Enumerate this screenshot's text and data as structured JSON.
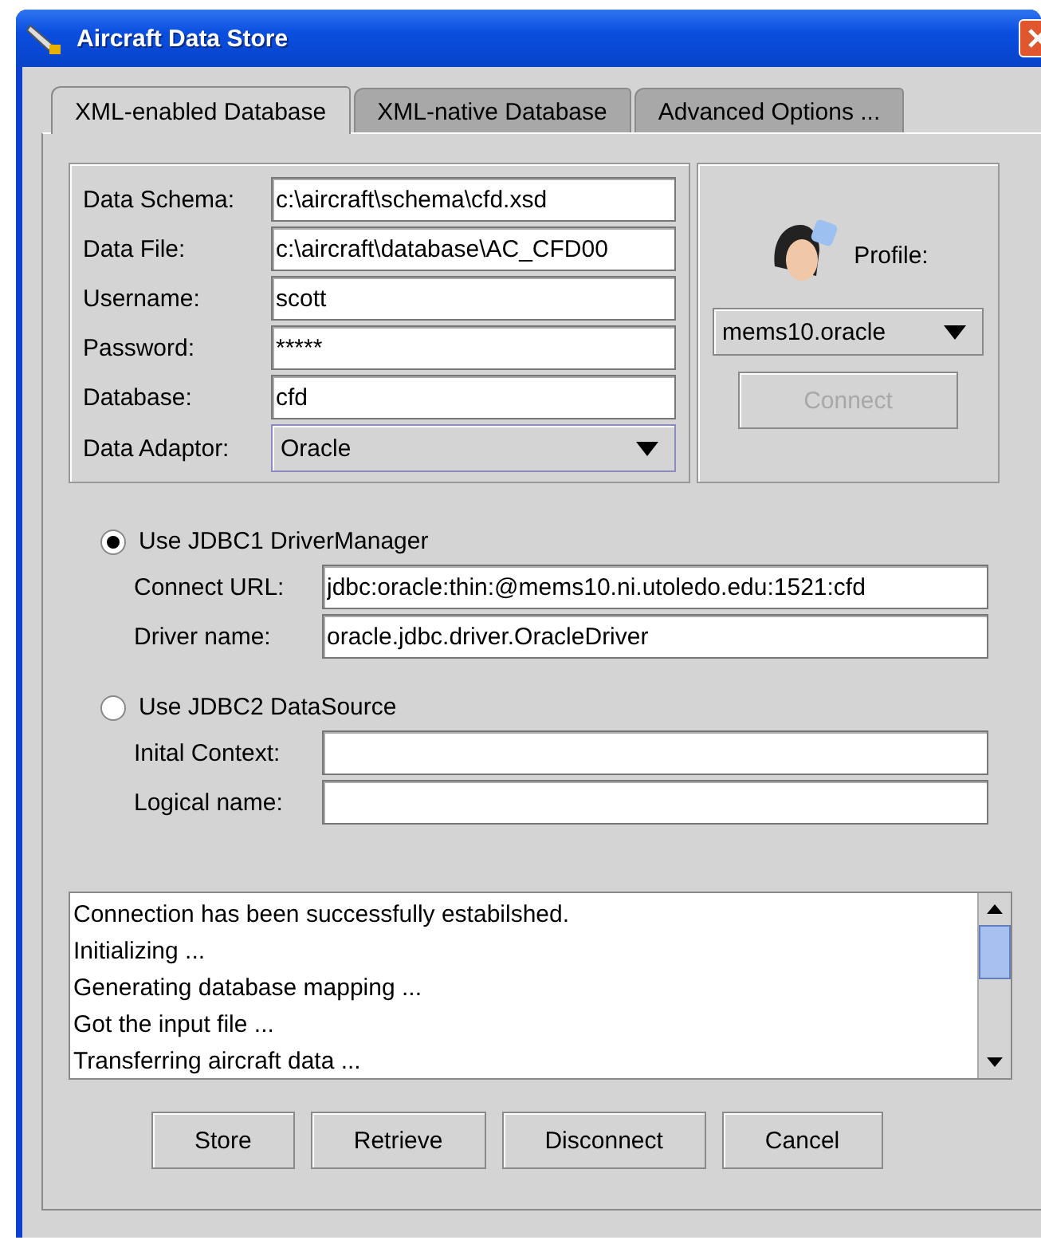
{
  "window": {
    "title": "Aircraft Data Store"
  },
  "tabs": [
    {
      "label": "XML-enabled Database",
      "selected": true
    },
    {
      "label": "XML-native Database",
      "selected": false
    },
    {
      "label": "Advanced Options ...",
      "selected": false
    }
  ],
  "fields": [
    {
      "label": "Data Schema:",
      "value": "c:\\aircraft\\schema\\cfd.xsd"
    },
    {
      "label": "Data File:",
      "value": "c:\\aircraft\\database\\AC_CFD00"
    },
    {
      "label": "Username:",
      "value": "scott"
    },
    {
      "label": "Password:",
      "value": "*****"
    },
    {
      "label": "Database:",
      "value": "cfd"
    }
  ],
  "adaptor": {
    "label": "Data Adaptor:",
    "value": "Oracle"
  },
  "profile": {
    "label": "Profile:",
    "value": "mems10.oracle"
  },
  "connect_button": {
    "label": "Connect",
    "disabled": true
  },
  "options": [
    {
      "label": "Use JDBC1 DriverManager",
      "selected": true,
      "fields": [
        {
          "label": "Connect URL:",
          "value": "jdbc:oracle:thin:@mems10.ni.utoledo.edu:1521:cfd"
        },
        {
          "label": "Driver name:",
          "value": "oracle.jdbc.driver.OracleDriver"
        }
      ]
    },
    {
      "label": "Use JDBC2 DataSource",
      "selected": false,
      "fields": [
        {
          "label": "Inital Context:"
        },
        {
          "label": "Logical name:"
        }
      ]
    }
  ],
  "log": [
    "Connection has been successfully estabilshed.",
    "Initializing ...",
    "Generating database mapping ...",
    "Got the input file ...",
    "Transferring aircraft data ..."
  ],
  "buttons": [
    "Store",
    "Retrieve",
    "Disconnect",
    "Cancel"
  ]
}
